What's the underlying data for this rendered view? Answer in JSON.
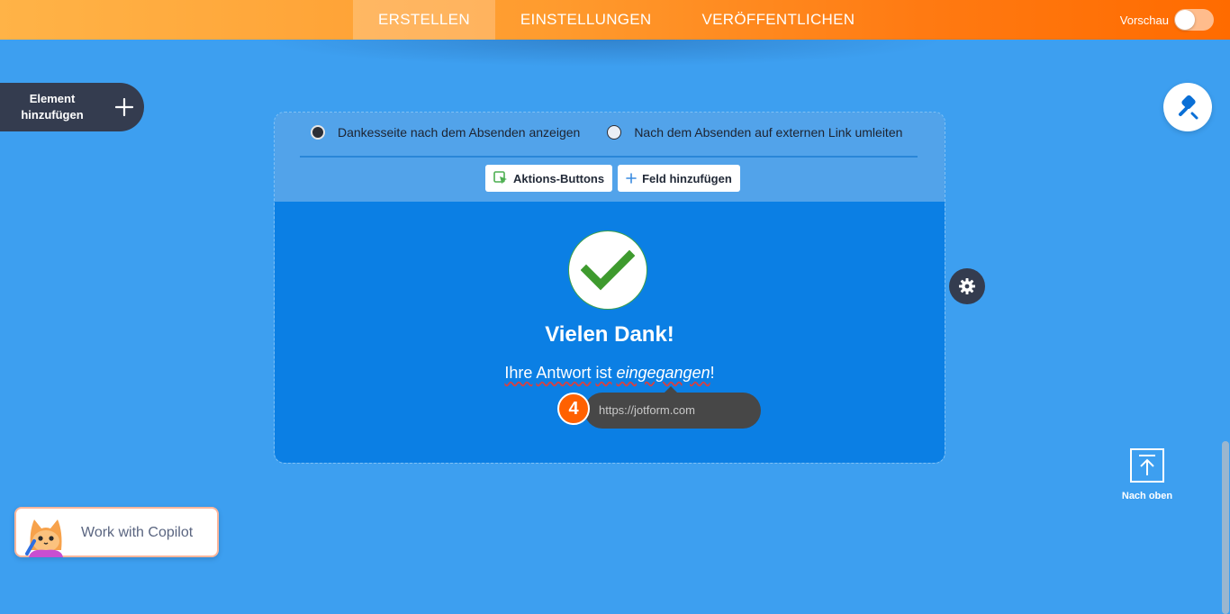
{
  "nav": {
    "tabs": [
      {
        "label": "ERSTELLEN",
        "active": true
      },
      {
        "label": "EINSTELLUNGEN",
        "active": false
      },
      {
        "label": "VERÖFFENTLICHEN",
        "active": false
      }
    ],
    "preview_label": "Vorschau",
    "preview_enabled": false
  },
  "sidebar": {
    "add_element_line1": "Element",
    "add_element_line2": "hinzufügen",
    "add_icon": "plus-icon"
  },
  "form": {
    "radio_options": [
      {
        "label": "Dankesseite nach dem Absenden anzeigen",
        "checked": true
      },
      {
        "label": "Nach dem Absenden auf externen Link umleiten",
        "checked": false
      }
    ],
    "buttons": {
      "actions": "Aktions-Buttons",
      "add_field": "Feld hinzufügen"
    },
    "thank_you": {
      "title": "Vielen Dank!",
      "message_prefix": "Ihre",
      "message_word2": "Antwort",
      "message_word3": "ist",
      "message_italic": "eingegangen",
      "message_suffix": "!"
    },
    "link_tooltip": {
      "placeholder": "https://jotform.com",
      "step_number": "4"
    }
  },
  "right": {
    "back_to_top_label": "Nach oben"
  },
  "copilot": {
    "label": "Work with Copilot"
  },
  "colors": {
    "background": "#3d9ff0",
    "accent_orange": "#ff6100",
    "success_green": "#3ea04b",
    "dark": "#343c4f"
  }
}
